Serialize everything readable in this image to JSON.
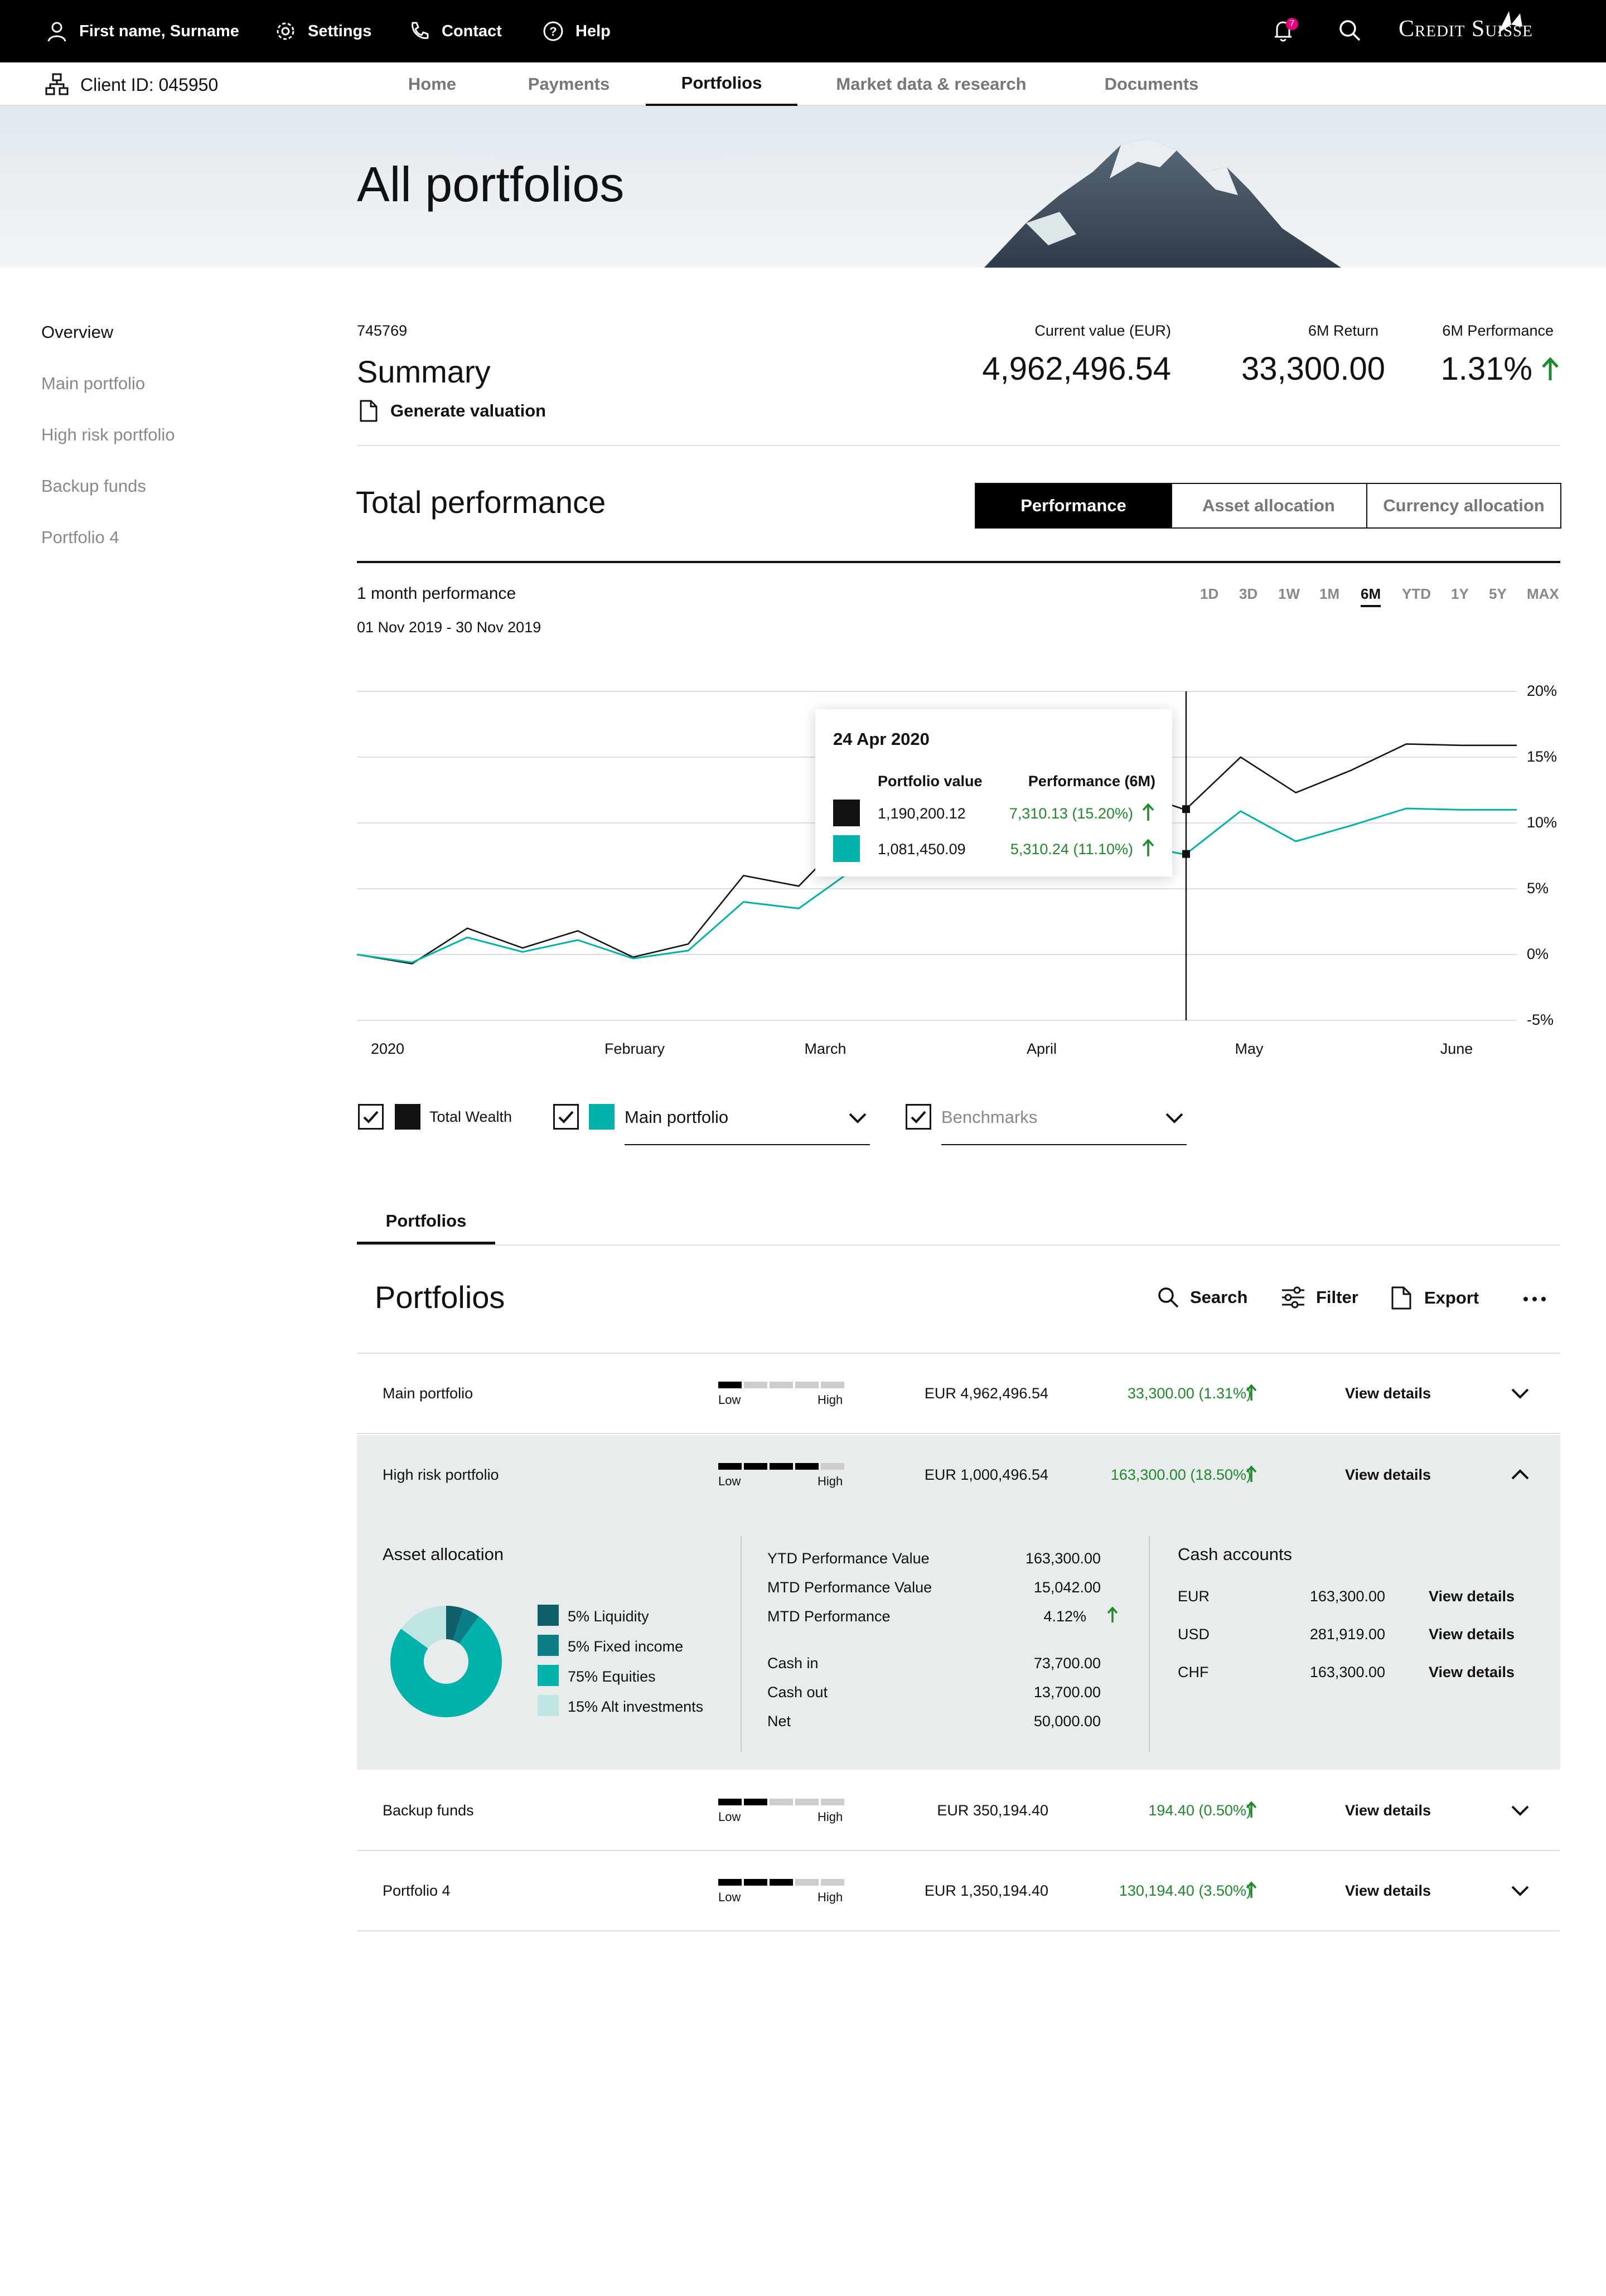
{
  "topbar": {
    "user_label": "First name, Surname",
    "settings_label": "Settings",
    "contact_label": "Contact",
    "help_label": "Help",
    "notification_count": "7",
    "brand": "Credit Suisse"
  },
  "subnav": {
    "client_id": "Client ID: 045950",
    "tabs": [
      {
        "label": "Home"
      },
      {
        "label": "Payments"
      },
      {
        "label": "Portfolios"
      },
      {
        "label": "Market data & research"
      },
      {
        "label": "Documents"
      }
    ]
  },
  "hero": {
    "title": "All portfolios"
  },
  "sidebar": {
    "items": [
      {
        "label": "Overview"
      },
      {
        "label": "Main portfolio"
      },
      {
        "label": "High risk portfolio"
      },
      {
        "label": "Backup funds"
      },
      {
        "label": "Portfolio 4"
      }
    ]
  },
  "summary": {
    "account_number": "745769",
    "title": "Summary",
    "generate_label": "Generate valuation",
    "current_value_label": "Current value (EUR)",
    "current_value": "4,962,496.54",
    "return_label": "6M Return",
    "return_value": "33,300.00",
    "perf_label": "6M Performance",
    "perf_value": "1.31%"
  },
  "performance": {
    "title": "Total performance",
    "segments": [
      {
        "label": "Performance"
      },
      {
        "label": "Asset allocation"
      },
      {
        "label": "Currency allocation"
      }
    ],
    "period_title": "1 month performance",
    "period_range": "01 Nov 2019 - 30 Nov 2019",
    "periods": [
      "1D",
      "3D",
      "1W",
      "1M",
      "6M",
      "YTD",
      "1Y",
      "5Y",
      "MAX"
    ],
    "active_period": "6M"
  },
  "chart_data": {
    "type": "line",
    "x": [
      "2020",
      "February",
      "March",
      "April",
      "May",
      "June"
    ],
    "y_ticks": [
      "20%",
      "15%",
      "10%",
      "5%",
      "0%",
      "-5%"
    ],
    "ylim": [
      -5,
      20
    ],
    "series": [
      {
        "name": "Total Wealth",
        "color": "#111111",
        "values": [
          0,
          -0.7,
          2,
          0.5,
          1.8,
          -0.2,
          0.8,
          6,
          5.2,
          9.5,
          12,
          12.8,
          13,
          12.7,
          12.4,
          11,
          15,
          12.3,
          14,
          16,
          15.9,
          15.9
        ]
      },
      {
        "name": "Main portfolio",
        "color": "#00b2a9",
        "values": [
          0,
          -0.6,
          1.3,
          0.2,
          1.1,
          -0.3,
          0.3,
          4,
          3.5,
          6.5,
          9,
          10,
          10.8,
          8.9,
          8.4,
          7.6,
          10.9,
          8.6,
          9.8,
          11.1,
          11,
          11
        ]
      }
    ],
    "tooltip": {
      "date": "24 Apr 2020",
      "col1": "Portfolio value",
      "col2": "Performance (6M)",
      "rows": [
        {
          "value": "1,190,200.12",
          "perf": "7,310.13 (15.20%)",
          "color": "#111111"
        },
        {
          "value": "1,081,450.09",
          "perf": "5,310.24 (11.10%)",
          "color": "#00b2a9"
        }
      ]
    }
  },
  "legend": {
    "total_wealth": "Total Wealth",
    "main_portfolio": "Main portfolio",
    "benchmarks": "Benchmarks"
  },
  "portfolios": {
    "tab_label": "Portfolios",
    "title": "Portfolios",
    "search_label": "Search",
    "filter_label": "Filter",
    "export_label": "Export",
    "risk_low": "Low",
    "risk_high": "High",
    "view_details": "View details",
    "rows": [
      {
        "name": "Main portfolio",
        "risk": 1,
        "value": "EUR 4,962,496.54",
        "perf": "33,300.00 (1.31%)"
      },
      {
        "name": "High risk portfolio",
        "risk": 4,
        "value": "EUR 1,000,496.54",
        "perf": "163,300.00 (18.50%)"
      },
      {
        "name": "Backup funds",
        "risk": 2,
        "value": "EUR 350,194.40",
        "perf": "194.40 (0.50%)"
      },
      {
        "name": "Portfolio 4",
        "risk": 3,
        "value": "EUR 1,350,194.40",
        "perf": "130,194.40 (3.50%)"
      }
    ]
  },
  "expanded": {
    "asset_title": "Asset allocation",
    "allocations": [
      {
        "label": "5% Liquidity",
        "pct": 5,
        "color": "#0e5f6a"
      },
      {
        "label": "5% Fixed income",
        "pct": 5,
        "color": "#0b7e86"
      },
      {
        "label": "75% Equities",
        "pct": 75,
        "color": "#00b2a9"
      },
      {
        "label": "15% Alt investments",
        "pct": 15,
        "color": "#bfe4e2"
      }
    ],
    "stats": [
      {
        "label": "YTD Performance Value",
        "value": "163,300.00"
      },
      {
        "label": "MTD Performance Value",
        "value": "15,042.00"
      },
      {
        "label": "MTD Performance",
        "value": "4.12%"
      },
      {
        "label": "Cash in",
        "value": "73,700.00"
      },
      {
        "label": "Cash out",
        "value": "13,700.00"
      },
      {
        "label": "Net",
        "value": "50,000.00"
      }
    ],
    "cash_title": "Cash accounts",
    "cash": [
      {
        "ccy": "EUR",
        "amount": "163,300.00"
      },
      {
        "ccy": "USD",
        "amount": "281,919.00"
      },
      {
        "ccy": "CHF",
        "amount": "163,300.00"
      }
    ]
  }
}
